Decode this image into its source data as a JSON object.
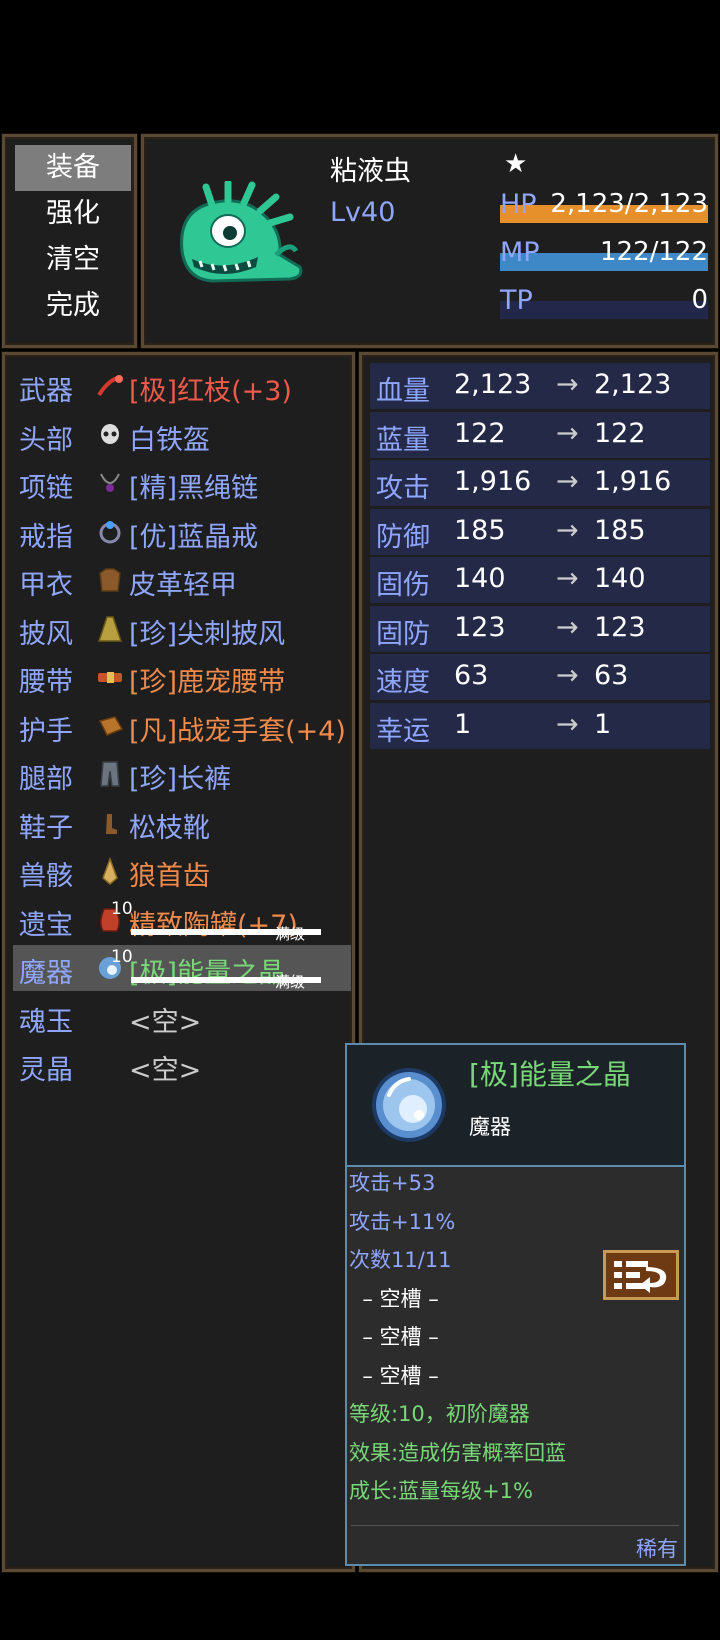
{
  "menu": {
    "items": [
      "装备",
      "强化",
      "清空",
      "完成"
    ],
    "selected_index": 0
  },
  "header": {
    "name": "粘液虫",
    "star": "★",
    "level": "Lv40",
    "bars": [
      {
        "label": "HP",
        "value": "2,123/2,123",
        "fill": 1.0,
        "color": "#e6902c"
      },
      {
        "label": "MP",
        "value": "122/122",
        "fill": 1.0,
        "color": "#3f88c8"
      },
      {
        "label": "TP",
        "value": "0",
        "fill": 0.0,
        "color": "#888888"
      }
    ]
  },
  "equipment": [
    {
      "slot": "武器",
      "name": "[极]红枝(+3)",
      "color": "#ee5a4a",
      "icon": "red-branch-icon"
    },
    {
      "slot": "头部",
      "name": "白铁盔",
      "color": "#8fa6ff",
      "icon": "skull-helmet-icon"
    },
    {
      "slot": "项链",
      "name": "[精]黑绳链",
      "color": "#8fa6ff",
      "icon": "necklace-icon"
    },
    {
      "slot": "戒指",
      "name": "[优]蓝晶戒",
      "color": "#8fa6ff",
      "icon": "ring-icon"
    },
    {
      "slot": "甲衣",
      "name": "皮革轻甲",
      "color": "#8fa6ff",
      "icon": "leather-armor-icon"
    },
    {
      "slot": "披风",
      "name": "[珍]尖刺披风",
      "color": "#8fa6ff",
      "icon": "cloak-icon"
    },
    {
      "slot": "腰带",
      "name": "[珍]鹿宠腰带",
      "color": "#ef8a4a",
      "icon": "belt-icon"
    },
    {
      "slot": "护手",
      "name": "[凡]战宠手套(+4)",
      "color": "#ef8a4a",
      "icon": "gloves-icon"
    },
    {
      "slot": "腿部",
      "name": "[珍]长裤",
      "color": "#8fa6ff",
      "icon": "pants-icon"
    },
    {
      "slot": "鞋子",
      "name": "松枝靴",
      "color": "#8fa6ff",
      "icon": "boots-icon"
    },
    {
      "slot": "兽骸",
      "name": "狼首齿",
      "color": "#ef8a4a",
      "icon": "fang-icon"
    },
    {
      "slot": "遗宝",
      "name": "精致陶罐(+7)",
      "color": "#ef8a4a",
      "icon": "jar-icon",
      "level": "10",
      "max_label": "满级"
    },
    {
      "slot": "魔器",
      "name": "[极]能量之晶",
      "color": "#78d878",
      "icon": "energy-crystal-icon",
      "level": "10",
      "max_label": "满级",
      "selected": true
    },
    {
      "slot": "魂玉",
      "name": "<空>",
      "color": "#cccccc",
      "icon": ""
    },
    {
      "slot": "灵晶",
      "name": "<空>",
      "color": "#cccccc",
      "icon": ""
    }
  ],
  "stats": {
    "arrow": "→",
    "rows": [
      {
        "label": "血量",
        "current": "2,123",
        "new": "2,123"
      },
      {
        "label": "蓝量",
        "current": "122",
        "new": "122"
      },
      {
        "label": "攻击",
        "current": "1,916",
        "new": "1,916"
      },
      {
        "label": "防御",
        "current": "185",
        "new": "185"
      },
      {
        "label": "固伤",
        "current": "140",
        "new": "140"
      },
      {
        "label": "固防",
        "current": "123",
        "new": "123"
      },
      {
        "label": "速度",
        "current": "63",
        "new": "63"
      },
      {
        "label": "幸运",
        "current": "1",
        "new": "1"
      }
    ]
  },
  "tooltip": {
    "title": "[极]能量之晶",
    "type": "魔器",
    "lines": [
      {
        "text": "攻击+53",
        "color": "#8fa6ff"
      },
      {
        "text": "攻击+11%",
        "color": "#8fa6ff"
      },
      {
        "text": "次数11/11",
        "color": "#8fa6ff"
      },
      {
        "text": "  – 空槽 –",
        "color": "#ffffff"
      },
      {
        "text": "  – 空槽 –",
        "color": "#ffffff"
      },
      {
        "text": "  – 空槽 –",
        "color": "#ffffff"
      },
      {
        "text": "等级:10，初阶魔器",
        "color": "#78d878"
      },
      {
        "text": "效果:造成伤害概率回蓝",
        "color": "#78d878"
      },
      {
        "text": "成长:蓝量每级+1%",
        "color": "#78d878"
      }
    ],
    "rarity": "稀有"
  }
}
